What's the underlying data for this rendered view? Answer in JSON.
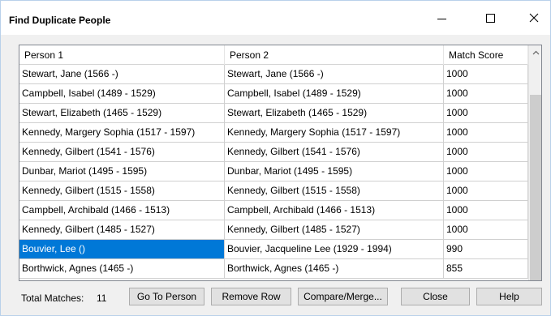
{
  "window": {
    "title": "Find Duplicate People"
  },
  "grid": {
    "columns": [
      "Person 1",
      "Person 2",
      "Match Score"
    ],
    "rows": [
      {
        "person1": "Stewart, Jane (1566 -)",
        "person2": "Stewart, Jane (1566 -)",
        "score": "1000"
      },
      {
        "person1": "Campbell, Isabel (1489 - 1529)",
        "person2": "Campbell, Isabel (1489 - 1529)",
        "score": "1000"
      },
      {
        "person1": "Stewart, Elizabeth (1465 - 1529)",
        "person2": "Stewart, Elizabeth (1465 - 1529)",
        "score": "1000"
      },
      {
        "person1": "Kennedy, Margery Sophia (1517 - 1597)",
        "person2": "Kennedy, Margery Sophia (1517 - 1597)",
        "score": "1000"
      },
      {
        "person1": "Kennedy, Gilbert (1541 - 1576)",
        "person2": "Kennedy, Gilbert (1541 - 1576)",
        "score": "1000"
      },
      {
        "person1": "Dunbar, Mariot (1495 - 1595)",
        "person2": "Dunbar, Mariot (1495 - 1595)",
        "score": "1000"
      },
      {
        "person1": "Kennedy, Gilbert (1515 - 1558)",
        "person2": "Kennedy, Gilbert (1515 - 1558)",
        "score": "1000"
      },
      {
        "person1": "Campbell, Archibald (1466 - 1513)",
        "person2": "Campbell, Archibald (1466 - 1513)",
        "score": "1000"
      },
      {
        "person1": "Kennedy, Gilbert (1485 - 1527)",
        "person2": "Kennedy, Gilbert (1485 - 1527)",
        "score": "1000"
      },
      {
        "person1": "Bouvier, Lee ()",
        "person2": "Bouvier, Jacqueline Lee (1929 - 1994)",
        "score": "990",
        "selected": true
      },
      {
        "person1": "Borthwick, Agnes (1465 -)",
        "person2": "Borthwick, Agnes (1465 -)",
        "score": "855"
      }
    ]
  },
  "footer": {
    "total_label": "Total Matches:",
    "total_value": "11",
    "buttons": {
      "go_to_person": "Go To Person",
      "remove_row": "Remove Row",
      "compare_merge": "Compare/Merge...",
      "close": "Close",
      "help": "Help"
    }
  },
  "icons": {
    "minimize": "minimize-icon",
    "maximize": "maximize-icon",
    "close": "close-icon",
    "scroll_up": "chevron-up-icon"
  },
  "colors": {
    "selection": "#0078d7",
    "window_bg": "#f0f0f0",
    "button_bg": "#e1e1e1"
  }
}
